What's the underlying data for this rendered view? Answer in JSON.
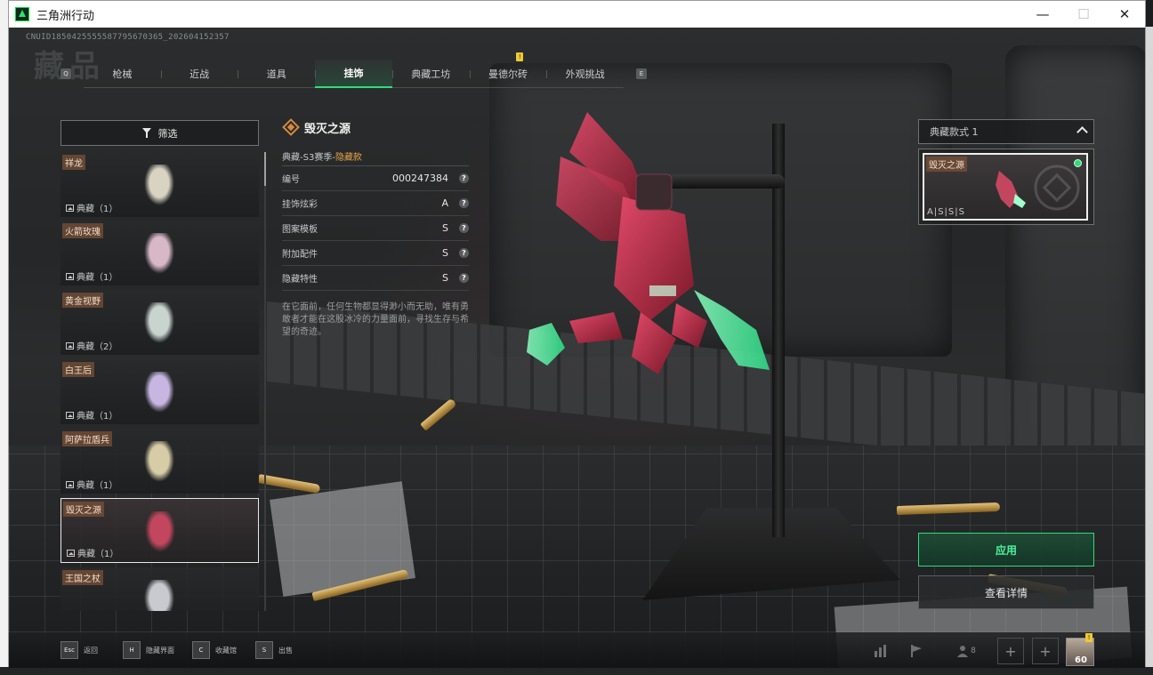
{
  "window": {
    "title": "三角洲行动",
    "minimize": "—",
    "maximize": "☐",
    "close": "✕"
  },
  "uid": "CNUID1850425555587795670365_202604152357",
  "watermark": "藏品",
  "tabs": [
    {
      "label": "枪械",
      "active": false
    },
    {
      "label": "近战",
      "active": false
    },
    {
      "label": "道具",
      "active": false
    },
    {
      "label": "挂饰",
      "active": true
    },
    {
      "label": "典藏工坊",
      "active": false
    },
    {
      "label": "曼德尔砖",
      "active": false,
      "notification": "!"
    },
    {
      "label": "外观挑战",
      "active": false
    }
  ],
  "tab_keys": {
    "left": "Q",
    "right": "E"
  },
  "filter": {
    "label": "筛选"
  },
  "items": [
    {
      "name": "祥龙",
      "count": "典藏（1）",
      "selected": false,
      "color": "#d9d3c2"
    },
    {
      "name": "火箭玫瑰",
      "count": "典藏（1）",
      "selected": false,
      "color": "#d8b7c7"
    },
    {
      "name": "黄金视野",
      "count": "典藏（2）",
      "selected": false,
      "color": "#c9d4cf"
    },
    {
      "name": "白王后",
      "count": "典藏（1）",
      "selected": false,
      "color": "#c8b6e2"
    },
    {
      "name": "阿萨拉盾兵",
      "count": "典藏（1）",
      "selected": false,
      "color": "#d6cca6"
    },
    {
      "name": "毁灭之源",
      "count": "典藏（1）",
      "selected": true,
      "color": "#c2475e"
    },
    {
      "name": "王国之杖",
      "count": "",
      "selected": false,
      "color": "#c9c9d0"
    }
  ],
  "detail": {
    "name": "毁灭之源",
    "season": "典藏-S3赛季-",
    "season_tag": "隐藏款",
    "attributes": [
      {
        "key": "编号",
        "value": "000247384"
      },
      {
        "key": "挂饰炫彩",
        "value": "A"
      },
      {
        "key": "图案模板",
        "value": "S"
      },
      {
        "key": "附加配件",
        "value": "S"
      },
      {
        "key": "隐藏特性",
        "value": "S"
      }
    ],
    "description": "在它面前，任何生物都显得渺小而无助，唯有勇敢者才能在这股冰冷的力量面前，寻找生存与希望的奇迹。"
  },
  "style_select": {
    "label": "典藏款式 1"
  },
  "preview": {
    "name": "毁灭之源",
    "grade": "A|S|S|S"
  },
  "buttons": {
    "apply": "应用",
    "view_detail": "查看详情"
  },
  "bottom_hints": [
    {
      "key": "Esc",
      "label": "返回"
    },
    {
      "key": "H",
      "label": "隐藏界面"
    },
    {
      "key": "C",
      "label": "收藏馆"
    },
    {
      "key": "S",
      "label": "出售"
    }
  ],
  "bottom_right": {
    "friends": "8",
    "level": "60",
    "badge": "!"
  },
  "colors": {
    "accent_green": "#2fdc7c",
    "accent_orange": "#d58a3c",
    "tag_orange": "#e6a64a"
  }
}
